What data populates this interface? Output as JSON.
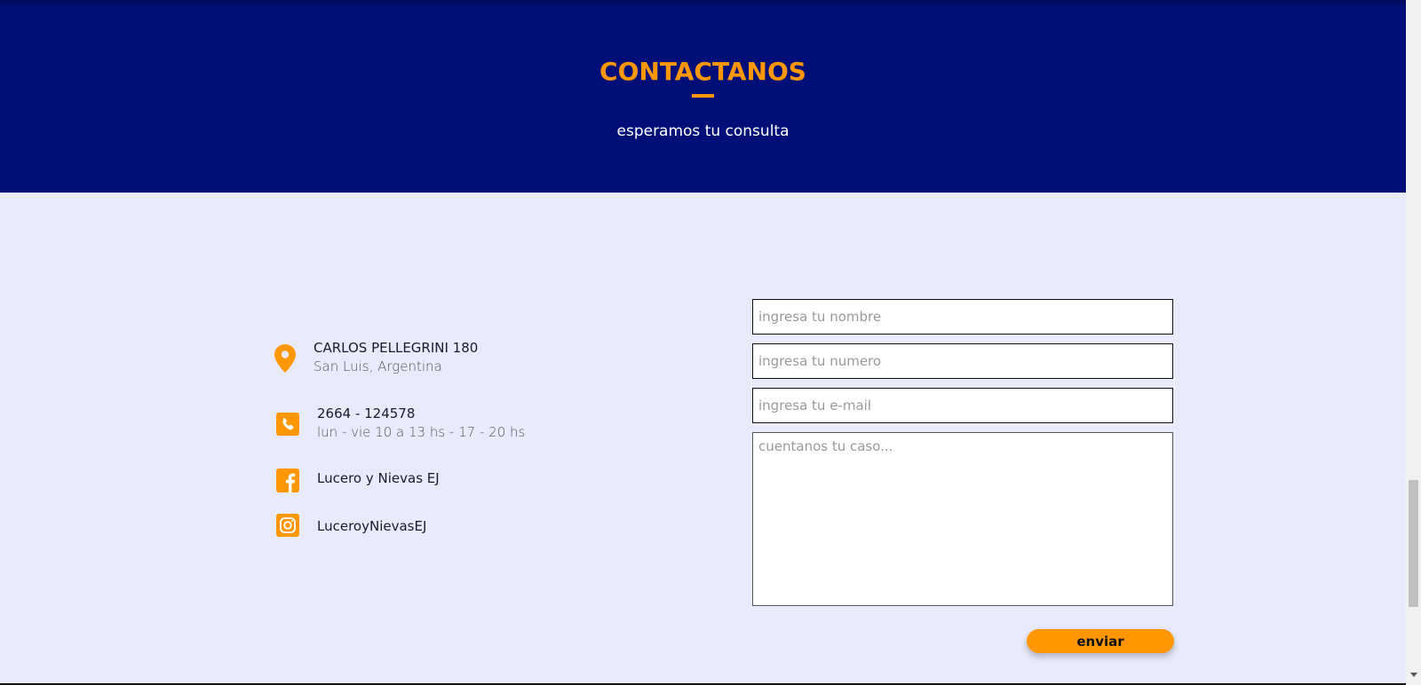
{
  "hero": {
    "title": "CONTACTANOS",
    "subtitle": "esperamos tu consulta"
  },
  "contact": {
    "address_line1": "CARLOS PELLEGRINI 180",
    "address_line2": "San Luis, Argentina",
    "phone": "2664 - 124578",
    "hours": "lun - vie 10 a 13 hs - 17 - 20 hs",
    "facebook": "Lucero y Nievas EJ",
    "instagram": "LuceroyNievasEJ"
  },
  "form": {
    "name_placeholder": "ingresa tu nombre",
    "phone_placeholder": "ingresa tu numero",
    "email_placeholder": "ingresa tu e-mail",
    "message_placeholder": "cuentanos tu caso...",
    "submit_label": "enviar"
  },
  "colors": {
    "hero_bg": "#000f78",
    "accent": "#ff9705",
    "page_bg": "#e9eafb"
  },
  "icons": [
    "location-pin-icon",
    "phone-icon",
    "facebook-icon",
    "instagram-icon"
  ]
}
